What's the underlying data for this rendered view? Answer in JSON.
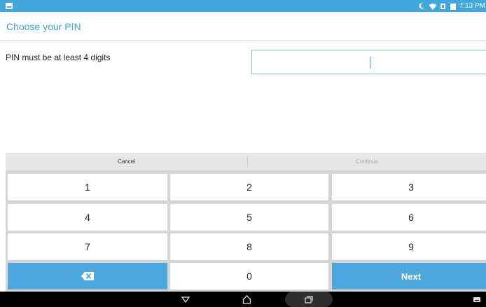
{
  "status_bar": {
    "time": "7:13 PM",
    "icons": [
      "notification-icon",
      "moon-icon",
      "wifi-icon",
      "signal-icon",
      "battery-icon"
    ]
  },
  "header": {
    "title": "Choose your PIN"
  },
  "pin": {
    "label": "PIN must be at least 4 digits",
    "value": ""
  },
  "actions": {
    "cancel": "Cancel",
    "continue": "Continue"
  },
  "keypad": {
    "row1": [
      "1",
      "2",
      "3"
    ],
    "row2": [
      "4",
      "5",
      "6"
    ],
    "row3": [
      "7",
      "8",
      "9"
    ],
    "zero": "0",
    "next": "Next",
    "delete_icon": "backspace-icon"
  },
  "nav": {
    "icons": [
      "back-icon",
      "home-icon",
      "recents-icon",
      "keyboard-icon"
    ]
  },
  "colors": {
    "accent": "#3fa7dc",
    "key_blue": "#4ea7dc",
    "title_text": "#3ea3d6"
  }
}
